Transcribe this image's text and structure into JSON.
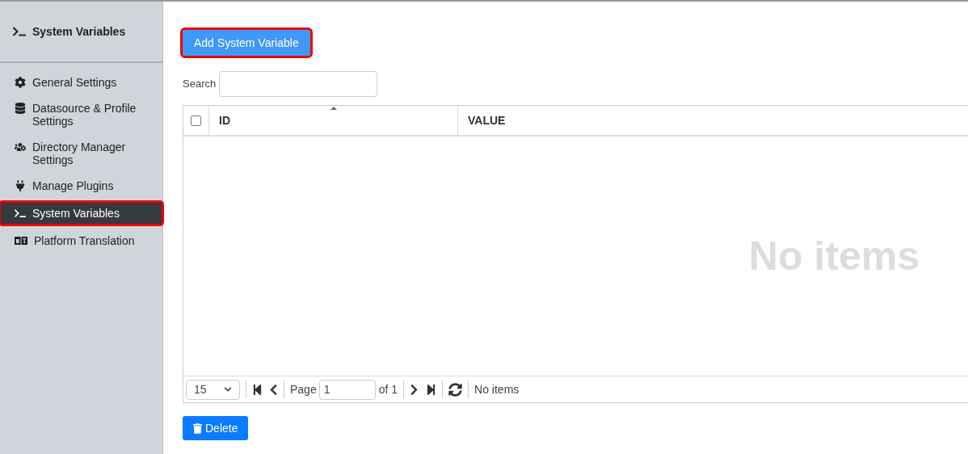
{
  "sidebar": {
    "title": "System Variables",
    "items": [
      {
        "label": "General Settings",
        "kind": "gear",
        "selected": false,
        "highlighted": false
      },
      {
        "label": "Datasource & Profile Settings",
        "kind": "database",
        "selected": false,
        "highlighted": false
      },
      {
        "label": "Directory Manager Settings",
        "kind": "users",
        "selected": false,
        "highlighted": false
      },
      {
        "label": "Manage Plugins",
        "kind": "plug",
        "selected": false,
        "highlighted": false
      },
      {
        "label": "System Variables",
        "kind": "terminal",
        "selected": true,
        "highlighted": true
      },
      {
        "label": "Platform Translation",
        "kind": "language",
        "selected": false,
        "highlighted": false
      }
    ]
  },
  "add_button": {
    "label": "Add System Variable",
    "highlighted": true
  },
  "search": {
    "label": "Search"
  },
  "table": {
    "select_all": {
      "checked": false
    },
    "columns": [
      {
        "label": "ID",
        "sorted": true
      },
      {
        "label": "VALUE",
        "sorted": false
      }
    ],
    "empty_message": "No items"
  },
  "pager": {
    "page_size": "15",
    "page_label": "Page",
    "page": "1",
    "of": "of 1",
    "status": "No items"
  },
  "delete_button": {
    "label": "Delete"
  }
}
